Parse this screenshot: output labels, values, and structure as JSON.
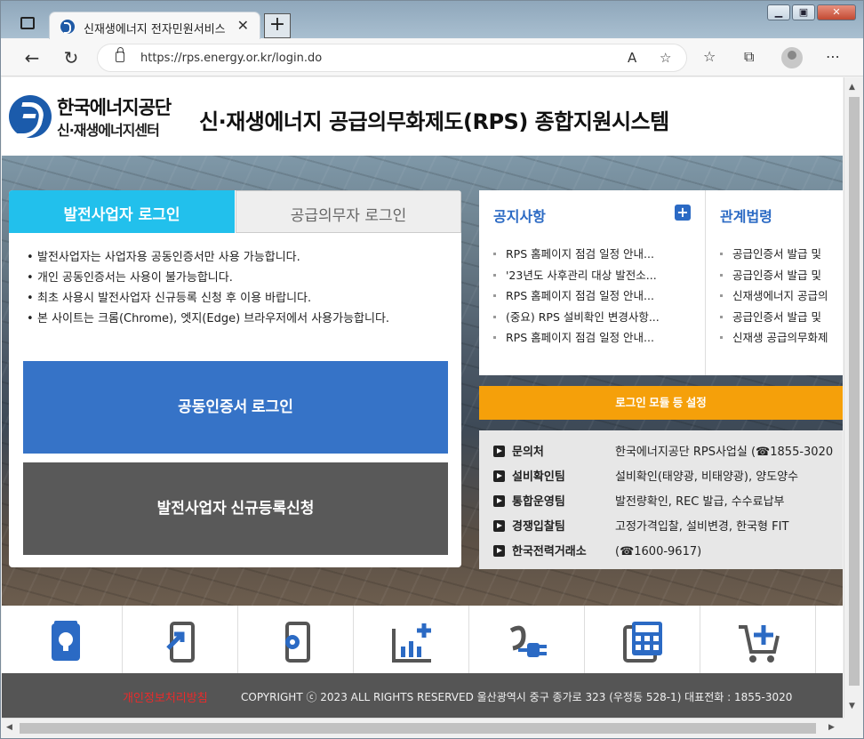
{
  "browser": {
    "tab_title": "신재생에너지 전자민원서비스",
    "url": "https://rps.energy.or.kr/login.do"
  },
  "header": {
    "logo_name": "한국에너지공단",
    "logo_sub": "신·재생에너지센터",
    "site_title": "신·재생에너지 공급의무화제도(RPS) 종합지원시스템"
  },
  "login": {
    "tab_active": "발전사업자 로그인",
    "tab_inactive": "공급의무자 로그인",
    "notices": [
      "발전사업자는 사업자용 공동인증서만 사용 가능합니다.",
      "개인 공동인증서는 사용이 불가능합니다.",
      "최초 사용시 발전사업자 신규등록 신청 후 이용 바랍니다.",
      "본 사이트는 크롬(Chrome), 엣지(Edge) 브라우저에서 사용가능합니다."
    ],
    "cert_button": "공동인증서 로그인",
    "register_button": "발전사업자 신규등록신청"
  },
  "notice_board": {
    "title": "공지사항",
    "items": [
      "RPS 홈페이지 점검 일정 안내...",
      "'23년도 사후관리 대상 발전소...",
      "RPS 홈페이지 점검 일정 안내...",
      "(중요) RPS 설비확인 변경사항...",
      "RPS 홈페이지 점검 일정 안내..."
    ]
  },
  "law_board": {
    "title": "관계법령",
    "items": [
      "공급인증서 발급 및",
      "공급인증서 발급 및",
      "신재생에너지 공급의",
      "공급인증서 발급 및",
      "신재생 공급의무화제"
    ]
  },
  "module_button": "로그인 모듈 등 설정",
  "contacts": [
    {
      "dept": "문의처",
      "info": "한국에너지공단 RPS사업실 (☎1855-3020"
    },
    {
      "dept": "설비확인팀",
      "info": "설비확인(태양광, 비태양광), 양도양수"
    },
    {
      "dept": "통합운영팀",
      "info": "발전량확인, REC 발급, 수수료납부"
    },
    {
      "dept": "경쟁입찰팀",
      "info": "고정가격입찰, 설비변경, 한국형 FIT"
    },
    {
      "dept": "한국전력거래소",
      "info": "(☎1600-9617)"
    }
  ],
  "quick_menu_icons": [
    "lightbulb-icon",
    "mobile-arrow-icon",
    "mobile-gear-icon",
    "chart-plus-icon",
    "plug-icon",
    "calculator-icon",
    "cart-plus-icon"
  ],
  "footer": {
    "privacy": "개인정보처리방침",
    "copyright": "COPYRIGHT ⓒ 2023 ALL RIGHTS RESERVED 울산광역시 중구 종가로 323 (우정동 528-1) 대표전화 : 1855-3020"
  },
  "colors": {
    "brand_blue": "#1b5bab",
    "login_tab_active": "#22c0ec",
    "cert_button": "#3673c7",
    "register_button": "#595959",
    "module_button": "#f5a00a",
    "board_title": "#2b6ac4",
    "privacy_link": "#e82b2b",
    "footer_bg": "#555555"
  }
}
